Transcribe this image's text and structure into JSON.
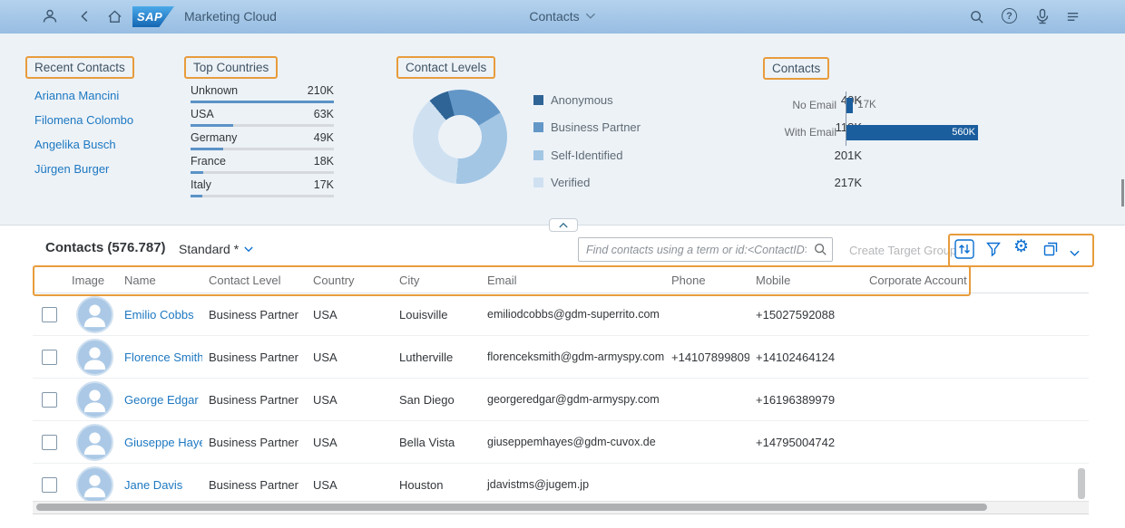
{
  "annotation": {
    "color": "#e89c3c"
  },
  "shell": {
    "logo_text": "SAP",
    "product_title": "Marketing Cloud",
    "center_title": "Contacts",
    "icons": {
      "question_glyph": "?",
      "gear_glyph": "⚙"
    }
  },
  "dashboard": {
    "recent_contacts": {
      "title": "Recent Contacts",
      "items": [
        "Arianna Mancini",
        "Filomena Colombo",
        "Angelika Busch",
        "Jürgen Burger"
      ]
    },
    "top_countries": {
      "title": "Top Countries",
      "chart_data": {
        "type": "bar",
        "categories": [
          "Unknown",
          "USA",
          "Germany",
          "France",
          "Italy"
        ],
        "value_labels": [
          "210K",
          "63K",
          "49K",
          "18K",
          "17K"
        ],
        "values": [
          210,
          63,
          49,
          18,
          17
        ],
        "bar_pct": [
          100,
          30,
          23,
          9,
          8
        ],
        "bar_color": "#5b93c6",
        "track_color": "#d6dade"
      }
    },
    "contact_levels": {
      "title": "Contact Levels",
      "chart_data": {
        "type": "pie",
        "donut": true,
        "start_deg": 320,
        "segments": [
          {
            "label": "Anonymous",
            "value_label": "40K",
            "value": 40,
            "pct": 7,
            "color": "#2e6496"
          },
          {
            "label": "Business Partner",
            "value_label": "118K",
            "value": 118,
            "pct": 20.5,
            "color": "#6397c7"
          },
          {
            "label": "Self-Identified",
            "value_label": "201K",
            "value": 201,
            "pct": 34.9,
            "color": "#a3c6e4"
          },
          {
            "label": "Verified",
            "value_label": "217K",
            "value": 217,
            "pct": 37.6,
            "color": "#cfe1f1"
          }
        ]
      }
    },
    "contacts_chart": {
      "title": "Contacts",
      "chart_data": {
        "type": "bar",
        "categories": [
          "No Email",
          "With Email"
        ],
        "value_labels": [
          "17K",
          "560K"
        ],
        "values": [
          17,
          560
        ],
        "bar_pct": [
          5,
          100
        ],
        "bar_color": "#1b5e9e"
      }
    }
  },
  "toolbar": {
    "table_title": "Contacts (576.787)",
    "view_selector": "Standard *",
    "search_placeholder": "Find contacts using a term or id:<ContactID>",
    "create_target_group_label": "Create Target Group"
  },
  "table": {
    "columns": {
      "image": "Image",
      "name": "Name",
      "contact_level": "Contact Level",
      "country": "Country",
      "city": "City",
      "email": "Email",
      "phone": "Phone",
      "mobile": "Mobile",
      "corporate_account": "Corporate Account"
    },
    "rows": [
      {
        "name": "Emilio Cobbs",
        "contact_level": "Business Partner",
        "country": "USA",
        "city": "Louisville",
        "email": "emiliodcobbs@gdm-superrito.com",
        "phone": "",
        "mobile": "+15027592088",
        "corporate_account": ""
      },
      {
        "name": "Florence Smith",
        "contact_level": "Business Partner",
        "country": "USA",
        "city": "Lutherville",
        "email": "florenceksmith@gdm-armyspy.com",
        "phone": "+14107899809",
        "mobile": "+14102464124",
        "corporate_account": ""
      },
      {
        "name": "George Edgar",
        "contact_level": "Business Partner",
        "country": "USA",
        "city": "San Diego",
        "email": "georgeredgar@gdm-armyspy.com",
        "phone": "",
        "mobile": "+16196389979",
        "corporate_account": ""
      },
      {
        "name": "Giuseppe Hayes",
        "contact_level": "Business Partner",
        "country": "USA",
        "city": "Bella Vista",
        "email": "giuseppemhayes@gdm-cuvox.de",
        "phone": "",
        "mobile": "+14795004742",
        "corporate_account": ""
      },
      {
        "name": "Jane Davis",
        "contact_level": "Business Partner",
        "country": "USA",
        "city": "Houston",
        "email": "jdavistms@jugem.jp",
        "phone": "",
        "mobile": "",
        "corporate_account": ""
      }
    ]
  }
}
